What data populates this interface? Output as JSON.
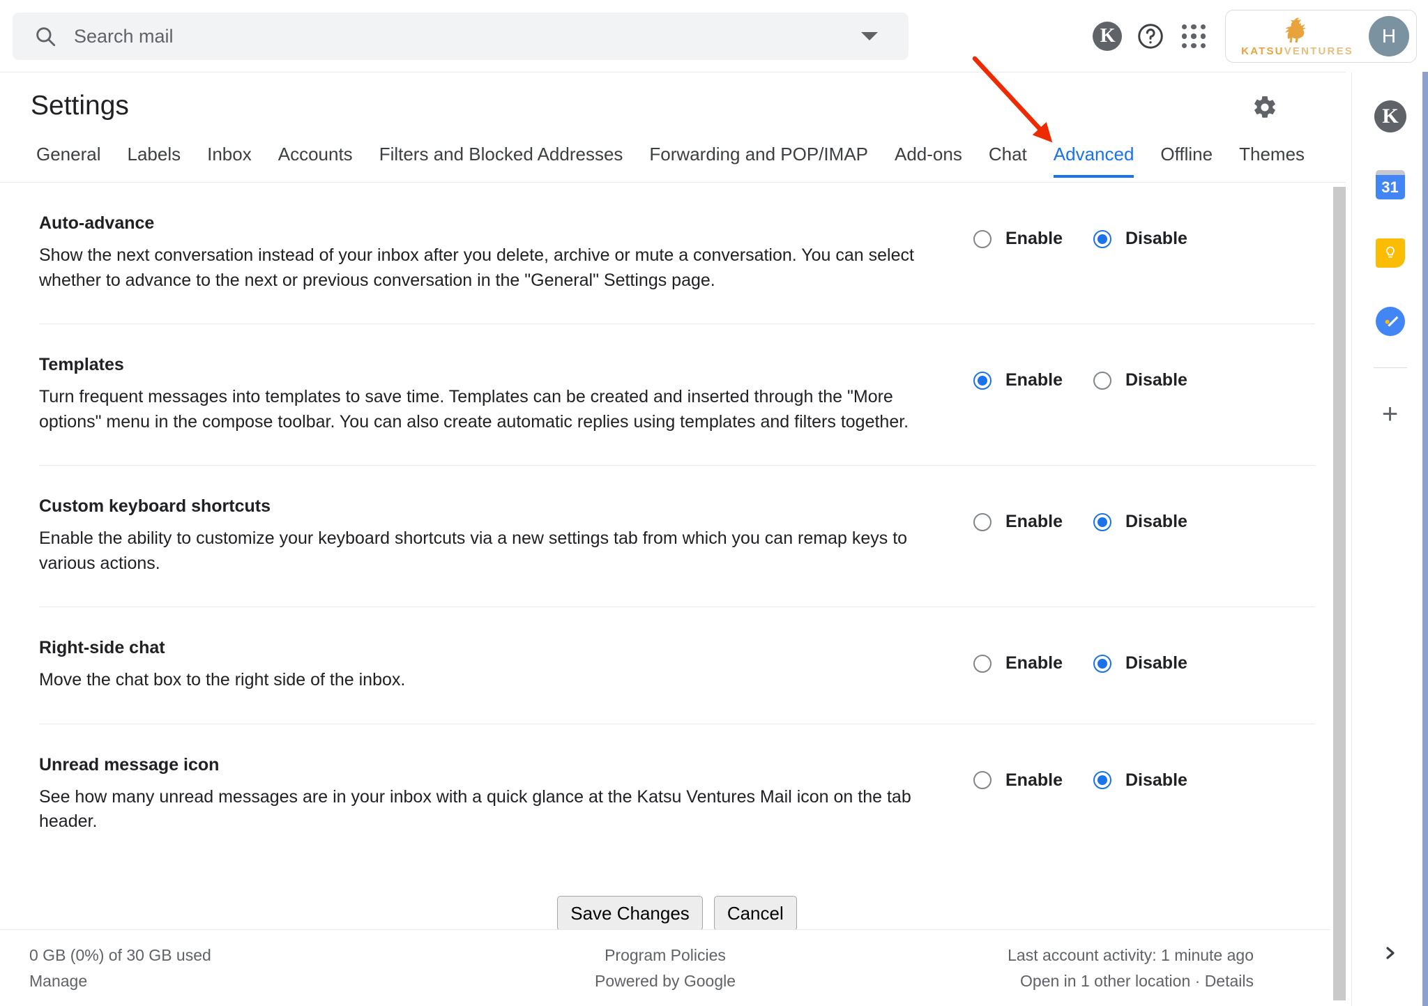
{
  "search": {
    "placeholder": "Search mail",
    "value": "",
    "icon": "search-icon",
    "dropdown_icon": "chevron-down-icon"
  },
  "topbar": {
    "workspace_badge": "K",
    "help_icon": "help-circle-icon",
    "apps_icon": "apps-grid-icon",
    "brand": {
      "name_part1": "KATSU",
      "name_part2": "VENTURES",
      "logo_icon": "rooster-logo-icon",
      "logo_color": "#e8a33d"
    },
    "avatar_initial": "H",
    "avatar_color": "#7b93a1"
  },
  "header": {
    "title": "Settings",
    "gear_icon": "gear-icon"
  },
  "tabs": [
    {
      "label": "General",
      "active": false
    },
    {
      "label": "Labels",
      "active": false
    },
    {
      "label": "Inbox",
      "active": false
    },
    {
      "label": "Accounts",
      "active": false
    },
    {
      "label": "Filters and Blocked Addresses",
      "active": false
    },
    {
      "label": "Forwarding and POP/IMAP",
      "active": false
    },
    {
      "label": "Add-ons",
      "active": false
    },
    {
      "label": "Chat",
      "active": false
    },
    {
      "label": "Advanced",
      "active": true
    },
    {
      "label": "Offline",
      "active": false
    },
    {
      "label": "Themes",
      "active": false
    }
  ],
  "accent_color": "#1a73e8",
  "annotation": {
    "type": "arrow",
    "color": "#ee2b00",
    "points_to": "Advanced"
  },
  "settings_rows": [
    {
      "title": "Auto-advance",
      "description": "Show the next conversation instead of your inbox after you delete, archive or mute a conversation. You can select whether to advance to the next or previous conversation in the \"General\" Settings page.",
      "enable_label": "Enable",
      "disable_label": "Disable",
      "selected": "Disable"
    },
    {
      "title": "Templates",
      "description": "Turn frequent messages into templates to save time. Templates can be created and inserted through the \"More options\" menu in the compose toolbar. You can also create automatic replies using templates and filters together.",
      "enable_label": "Enable",
      "disable_label": "Disable",
      "selected": "Enable"
    },
    {
      "title": "Custom keyboard shortcuts",
      "description": "Enable the ability to customize your keyboard shortcuts via a new settings tab from which you can remap keys to various actions.",
      "enable_label": "Enable",
      "disable_label": "Disable",
      "selected": "Disable"
    },
    {
      "title": "Right-side chat",
      "description": "Move the chat box to the right side of the inbox.",
      "enable_label": "Enable",
      "disable_label": "Disable",
      "selected": "Disable"
    },
    {
      "title": "Unread message icon",
      "description": "See how many unread messages are in your inbox with a quick glance at the Katsu Ventures Mail icon on the tab header.",
      "enable_label": "Enable",
      "disable_label": "Disable",
      "selected": "Disable"
    }
  ],
  "actions": {
    "save_label": "Save Changes",
    "cancel_label": "Cancel"
  },
  "footer": {
    "storage": "0 GB (0%) of 30 GB used",
    "manage": "Manage",
    "policies": "Program Policies",
    "powered": "Powered by Google",
    "activity": "Last account activity: 1 minute ago",
    "locations": "Open in 1 other location · Details"
  },
  "side_rail": {
    "items": [
      {
        "name": "workspace-k-icon",
        "label": "K"
      },
      {
        "name": "calendar-icon",
        "label": "31"
      },
      {
        "name": "keep-icon",
        "label": ""
      },
      {
        "name": "tasks-icon",
        "label": ""
      }
    ],
    "add_label": "+",
    "expand_icon": "chevron-right-icon"
  }
}
